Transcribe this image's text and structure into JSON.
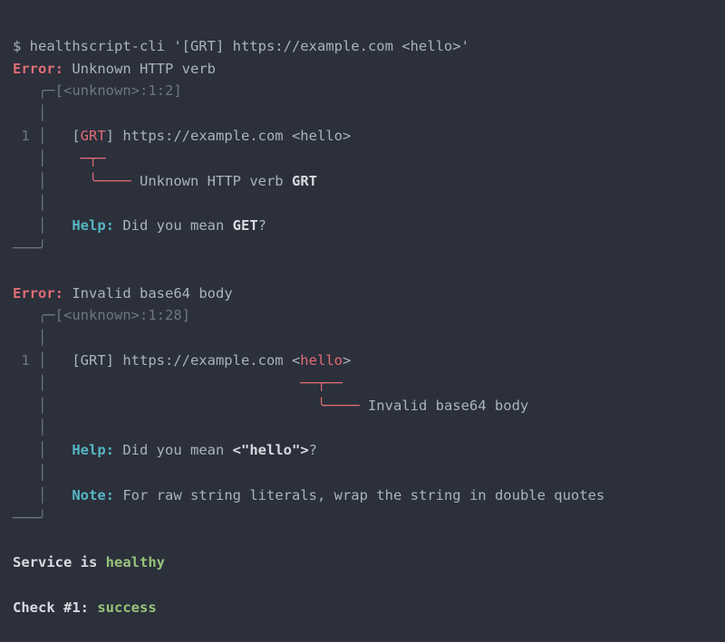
{
  "command": {
    "prompt": "$ ",
    "bin": "healthscript-cli ",
    "arg": "'[GRT] https://example.com <hello>'"
  },
  "err1": {
    "label": "Error:",
    "sp1": " ",
    "title": "Unknown HTTP verb",
    "loc_pre": "   ╭─",
    "loc": "[<unknown>:1:2]",
    "blank_gut": "   │",
    "num_gut": " 1 │",
    "code_sp": "   ",
    "code_lb": "[",
    "code_verb": "GRT",
    "code_rest": "] https://example.com <hello>",
    "ptr_gut": "   │",
    "ptr_sp": "    ",
    "ptr_line": "─┬─",
    "arrow_gut": "   │",
    "arrow_sp": "     ",
    "arrow_line": "╰──── ",
    "msg_pre": "Unknown HTTP verb ",
    "msg_bold": "GRT",
    "help_gut": "   │",
    "help_sp": "   ",
    "help_label": "Help:",
    "help_sp2": " ",
    "help_text": "Did you mean ",
    "help_bold": "GET",
    "help_q": "?",
    "end_gut": "───╯"
  },
  "spacer1": "",
  "err2": {
    "label": "Error:",
    "sp1": " ",
    "title": "Invalid base64 body",
    "loc_pre": "   ╭─",
    "loc": "[<unknown>:1:28]",
    "blank_gut": "   │",
    "num_gut": " 1 │",
    "code_sp": "   ",
    "code_pre": "[GRT] https://example.com <",
    "code_hl": "hello",
    "code_post": ">",
    "ptr_gut": "   │",
    "ptr_sp": "                              ",
    "ptr_line": "──┬──",
    "arrow_gut": "   │",
    "arrow_sp": "                                ",
    "arrow_line": "╰──── ",
    "msg": "Invalid base64 body",
    "help_gut": "   │",
    "help_sp": "   ",
    "help_label": "Help:",
    "help_sp2": " ",
    "help_text": "Did you mean ",
    "help_bold": "<\"hello\">",
    "help_q": "?",
    "note_gut": "   │",
    "note_sp": "   ",
    "note_label": "Note:",
    "note_sp2": " ",
    "note_text": "For raw string literals, wrap the string in double quotes",
    "end_gut": "───╯"
  },
  "spacer2": "",
  "summary": {
    "svc_pre": "Service is ",
    "svc_state": "healthy",
    "blank": "",
    "chk_pre": "Check #1: ",
    "chk_state": "success"
  }
}
